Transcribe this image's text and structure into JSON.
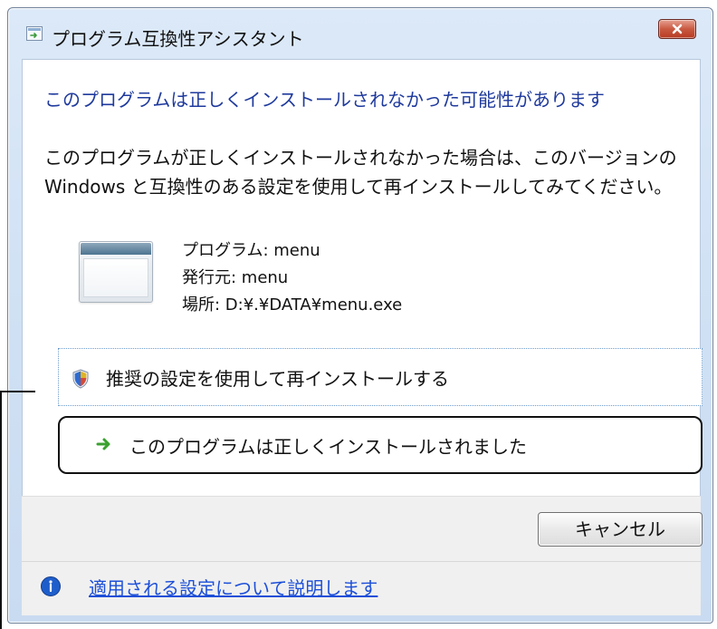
{
  "window": {
    "title": "プログラム互換性アシスタント"
  },
  "dialog": {
    "main_instruction": "このプログラムは正しくインストールされなかった可能性があります",
    "description": "このプログラムが正しくインストールされなかった場合は、このバージョンの Windows と互換性のある設定を使用して再インストールしてみてください。",
    "program_name_line": "プログラム: menu",
    "publisher_line": "発行元: menu",
    "location_line": "場所: D:¥.¥DATA¥menu.exe",
    "recommended_option": "推奨の設定を使用して再インストールする",
    "installed_correctly_option": "このプログラムは正しくインストールされました",
    "cancel_label": "キャンセル",
    "help_link": "適用される設定について説明します"
  },
  "icons": {
    "app": "compatibility-app-icon",
    "close": "close-icon",
    "program": "program-window-icon",
    "shield": "uac-shield-icon",
    "arrow": "green-arrow-icon",
    "help": "info-icon"
  },
  "colors": {
    "title_text": "#111111",
    "instruction": "#1f3a9d",
    "link": "#1d4fd8",
    "close_red": "#c8573f",
    "arrow_green": "#3aa12f"
  }
}
